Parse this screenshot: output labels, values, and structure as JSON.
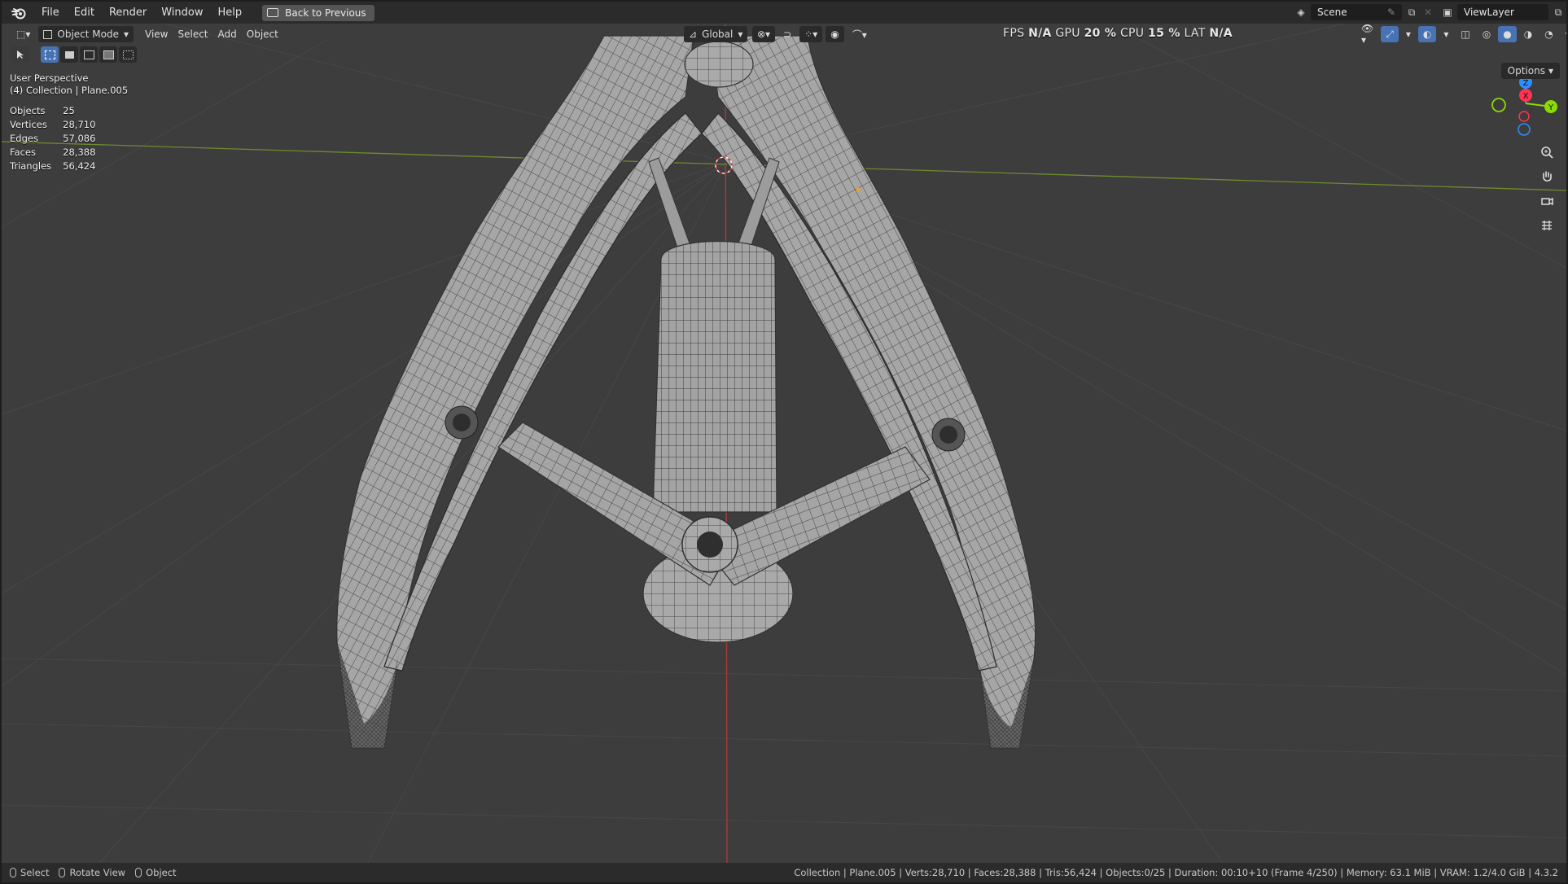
{
  "menu": {
    "items": [
      "File",
      "Edit",
      "Render",
      "Window",
      "Help"
    ],
    "back_button": "Back to Previous"
  },
  "topbar_right": {
    "scene": "Scene",
    "view_layer": "ViewLayer"
  },
  "viewport_header": {
    "mode": "Object Mode",
    "menus": [
      "View",
      "Select",
      "Add",
      "Object"
    ],
    "transform_orientation": "Global",
    "options_label": "Options"
  },
  "performance": {
    "fps_label": "FPS",
    "fps_value": "N/A",
    "gpu_label": "GPU",
    "gpu_value": "20 %",
    "cpu_label": "CPU",
    "cpu_value": "15 %",
    "lat_label": "LAT",
    "lat_value": "N/A"
  },
  "overlay_info": {
    "view_name": "User Perspective",
    "collection_line": "(4) Collection | Plane.005",
    "stats": [
      {
        "label": "Objects",
        "value": "25"
      },
      {
        "label": "Vertices",
        "value": "28,710"
      },
      {
        "label": "Edges",
        "value": "57,086"
      },
      {
        "label": "Faces",
        "value": "28,388"
      },
      {
        "label": "Triangles",
        "value": "56,424"
      }
    ]
  },
  "gizmo": {
    "axes": [
      "Z",
      "X",
      "Y"
    ],
    "colors": {
      "x": "#ff3352",
      "y": "#8bdc00",
      "z": "#2c8fff"
    }
  },
  "statusbar": {
    "left": [
      {
        "label": "Select"
      },
      {
        "label": "Rotate View"
      },
      {
        "label": "Object"
      }
    ],
    "right": "Collection | Plane.005 | Verts:28,710 | Faces:28,388 | Tris:56,424 | Objects:0/25 | Duration: 00:10+10 (Frame 4/250) | Memory: 63.1 MiB | VRAM: 1.2/4.0 GiB | 4.3.2"
  },
  "icons": [
    "blender-logo-icon",
    "editor-type-icon",
    "object-mode-icon",
    "select-box-icon",
    "transform-icon",
    "snap-icon",
    "proportional-icon",
    "visibility-icon",
    "gizmo-toggle-icon",
    "overlay-icon",
    "xray-icon",
    "wireframe-shading-icon",
    "solid-shading-icon",
    "material-shading-icon",
    "rendered-shading-icon",
    "zoom-icon",
    "pan-hand-icon",
    "camera-view-icon",
    "grid-ortho-icon"
  ]
}
